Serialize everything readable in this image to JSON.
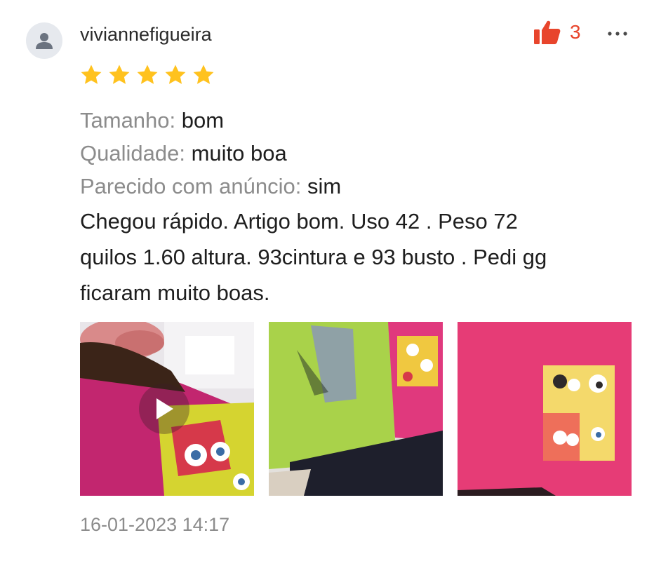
{
  "review": {
    "username": "viviannefigueira",
    "avatar_icon": "user-silhouette-icon",
    "like_icon": "thumbs-up-icon",
    "like_count": "3",
    "more_icon": "more-horizontal-icon",
    "rating": 5,
    "rating_max": 5,
    "attributes": [
      {
        "label": "Tamanho:",
        "value": "bom"
      },
      {
        "label": "Qualidade:",
        "value": "muito boa"
      },
      {
        "label": "Parecido com anúncio:",
        "value": "sim"
      }
    ],
    "text_lines": [
      "Chegou rápido. Artigo bom. Uso 42 . Peso 72",
      "quilos 1.60 altura. 93cintura e 93 busto . Pedi gg",
      "ficaram muito boas."
    ],
    "media": [
      {
        "type": "video",
        "icon": "play-icon"
      },
      {
        "type": "image"
      },
      {
        "type": "image"
      }
    ],
    "date": "16-01-2023 14:17"
  },
  "colors": {
    "accent": "#e8452c",
    "star": "#ffc21e",
    "muted_text": "#8c8c8c",
    "text": "#1e1e1e"
  }
}
